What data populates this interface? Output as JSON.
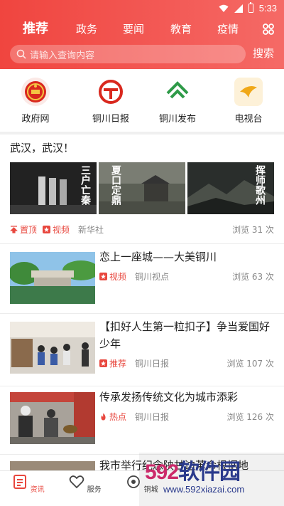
{
  "status": {
    "time": "5:33"
  },
  "nav": {
    "tabs": [
      "推荐",
      "政务",
      "要闻",
      "教育",
      "疫情"
    ],
    "active_tab": 0
  },
  "search": {
    "placeholder": "请输入查询内容",
    "button": "搜索"
  },
  "quick_links": [
    {
      "label": "政府网",
      "icon": "national-emblem-icon"
    },
    {
      "label": "铜川日报",
      "icon": "tongchuan-daily-logo-icon"
    },
    {
      "label": "铜川发布",
      "icon": "tongchuan-release-logo-icon"
    },
    {
      "label": "电视台",
      "icon": "tv-station-logo-icon"
    }
  ],
  "featured": {
    "title": "武汉，武汉！",
    "image_captions": [
      "三户亡秦",
      "夏口定鼎",
      "挥师歌州"
    ],
    "tags": [
      "置顶",
      "视频"
    ],
    "source": "新华社",
    "views": "浏览 31 次"
  },
  "news": [
    {
      "title": "恋上一座城——大美铜川",
      "tag": "视频",
      "source": "铜川视点",
      "views": "浏览 63 次"
    },
    {
      "title": "【扣好人生第一粒扣子】争当爱国好少年",
      "tag": "推荐",
      "source": "铜川日报",
      "views": "浏览 107 次"
    },
    {
      "title": "传承发扬传统文化为城市添彩",
      "tag": "热点",
      "source": "铜川日报",
      "views": "浏览 126 次"
    },
    {
      "title": "我市举行纪念陕甘边革命根据地"
    }
  ],
  "bottom_nav": [
    {
      "label": "资讯",
      "icon": "news-icon",
      "active": true
    },
    {
      "label": "服务",
      "icon": "heart-icon",
      "active": false
    },
    {
      "label": "铜城",
      "icon": "city-icon",
      "active": false
    }
  ],
  "watermark": {
    "logo_main": "592",
    "logo_rest": "软件园",
    "url": "www.592xiazai.com"
  },
  "colors": {
    "accent": "#e8473e",
    "header": "#f0453f"
  }
}
